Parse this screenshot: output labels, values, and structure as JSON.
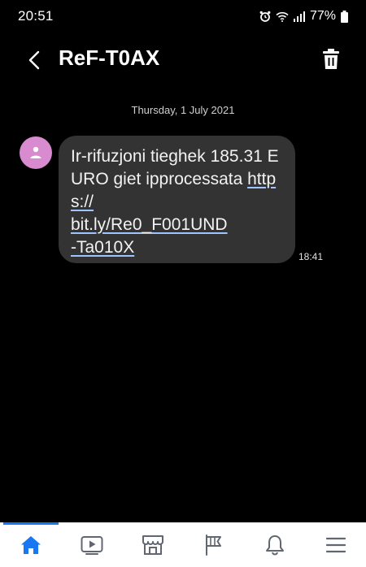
{
  "status_bar": {
    "time": "20:51",
    "battery": "77%"
  },
  "header": {
    "title": "ReF-T0AX"
  },
  "conversation": {
    "date": "Thursday, 1 July 2021",
    "message": {
      "text": "Ir-rifuzjoni tieghek 185.31 EURO giet ipprocessata ",
      "link": "https://bit.ly/Re0_F001UND-Ta010X",
      "link_line1": "https://",
      "link_line2": "bit.ly/Re0_F001UND",
      "link_line3": "-Ta010X",
      "time": "18:41"
    }
  },
  "colors": {
    "background": "#000000",
    "bubble": "#333333",
    "avatar": "#d98bd0",
    "nav_active": "#1877f2",
    "nav_inactive": "#606770"
  },
  "bottom_nav": {
    "items": [
      {
        "icon": "home-icon",
        "active": true
      },
      {
        "icon": "watch-icon",
        "active": false
      },
      {
        "icon": "marketplace-icon",
        "active": false
      },
      {
        "icon": "pages-flag-icon",
        "active": false
      },
      {
        "icon": "notifications-bell-icon",
        "active": false
      },
      {
        "icon": "menu-icon",
        "active": false
      }
    ]
  }
}
